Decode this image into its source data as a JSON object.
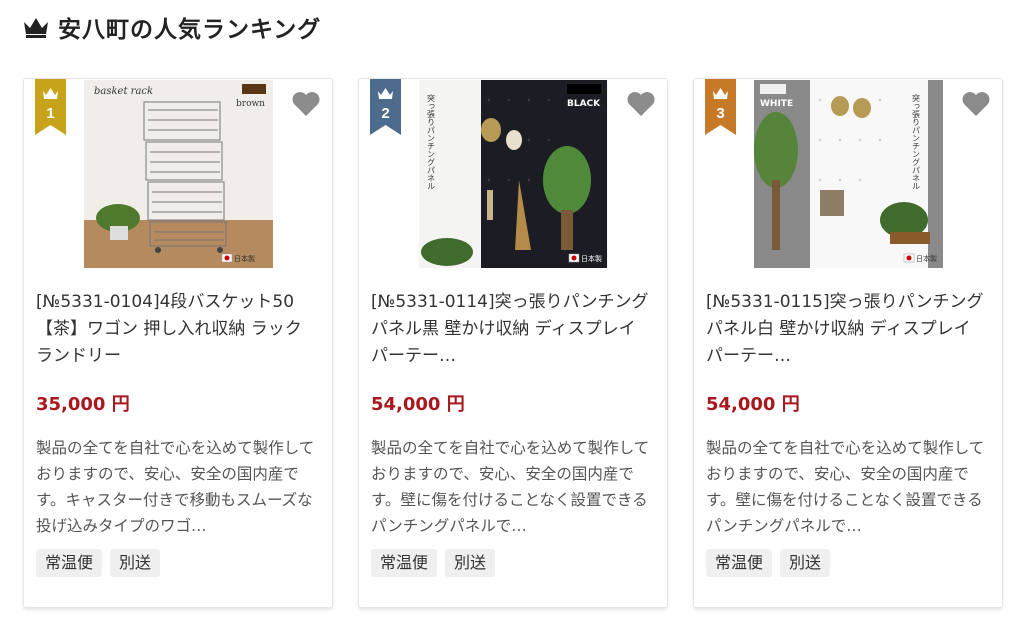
{
  "section": {
    "title": "安八町の人気ランキング",
    "icon": "crown-icon"
  },
  "colors": {
    "gold": "#c7a21b",
    "silver": "#4d6b8c",
    "bronze": "#c67a27",
    "price": "#a8181e",
    "heart": "#8c8c8c"
  },
  "products": [
    {
      "rank": "1",
      "name": "[№5331-0104]4段バスケット50【茶】ワゴン 押し入れ収納 ラック ランドリー",
      "price": "35,000 円",
      "description": "製品の全てを自社で心を込めて製作しておりますので、安心、安全の国内産です。キャスター付きで移動もスムーズな投げ込みタイプのワゴ…",
      "tags": [
        "常温便",
        "別送"
      ],
      "image": {
        "caption": "basket rack",
        "color_label": "brown",
        "badge": "日本製"
      }
    },
    {
      "rank": "2",
      "name": "[№5331-0114]突っ張りパンチングパネル黒 壁かけ収納 ディスプレイ パーテー…",
      "price": "54,000 円",
      "description": "製品の全てを自社で心を込めて製作しておりますので、安心、安全の国内産です。壁に傷を付けることなく設置できるパンチングパネルで…",
      "tags": [
        "常温便",
        "別送"
      ],
      "image": {
        "caption": "突っ張りパンチングパネル",
        "color_label": "BLACK",
        "badge": "日本製"
      }
    },
    {
      "rank": "3",
      "name": "[№5331-0115]突っ張りパンチングパネル白 壁かけ収納 ディスプレイ パーテー…",
      "price": "54,000 円",
      "description": "製品の全てを自社で心を込めて製作しておりますので、安心、安全の国内産です。壁に傷を付けることなく設置できるパンチングパネルで…",
      "tags": [
        "常温便",
        "別送"
      ],
      "image": {
        "caption": "突っ張りパンチングパネル",
        "color_label": "WHITE",
        "badge": "日本製"
      }
    }
  ]
}
